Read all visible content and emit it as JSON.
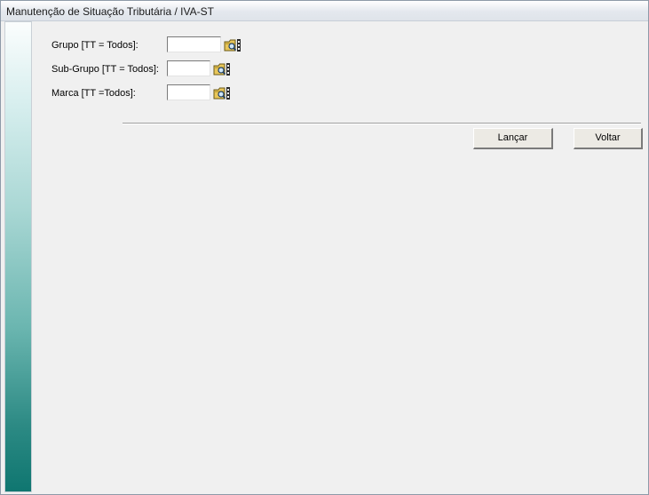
{
  "window": {
    "title": "Manutenção de Situação Tributária / IVA-ST"
  },
  "filters": {
    "grupo": {
      "label": "Grupo [TT = Todos]:",
      "value": "",
      "lookup_icon": "folder-search-icon"
    },
    "subgrupo": {
      "label": "Sub-Grupo [TT = Todos]:",
      "value": "",
      "lookup_icon": "folder-search-icon"
    },
    "marca": {
      "label": "Marca [TT =Todos]:",
      "value": "",
      "lookup_icon": "folder-search-icon"
    }
  },
  "actions": {
    "lancar_label": "Lançar",
    "voltar_label": "Voltar"
  },
  "colors": {
    "sidebar_top": "#fbfdfd",
    "sidebar_bottom": "#0f7670",
    "window_bg": "#f0f0f0"
  }
}
